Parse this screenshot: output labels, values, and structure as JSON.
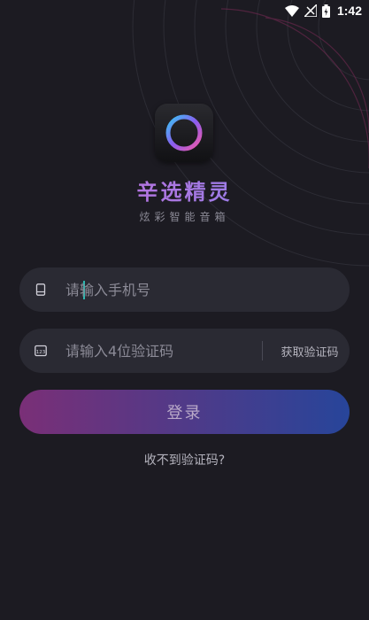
{
  "status_bar": {
    "time": "1:42",
    "battery_level": "5"
  },
  "app": {
    "name": "辛选精灵",
    "tagline": "炫彩智能音箱"
  },
  "phone_input": {
    "placeholder": "请输入手机号",
    "value": ""
  },
  "code_input": {
    "placeholder": "请输入4位验证码",
    "value": "",
    "get_code_label": "获取验证码"
  },
  "login_button": {
    "label": "登录"
  },
  "help_link": {
    "label": "收不到验证码?"
  },
  "colors": {
    "background": "#1c1b22",
    "input_background": "#2a2a33",
    "button_gradient_start": "#7a2f77",
    "button_gradient_end": "#27459a",
    "brand_gradient_start": "#d26ad8",
    "brand_gradient_end": "#7d86ee",
    "caret": "#2fb7b0"
  }
}
